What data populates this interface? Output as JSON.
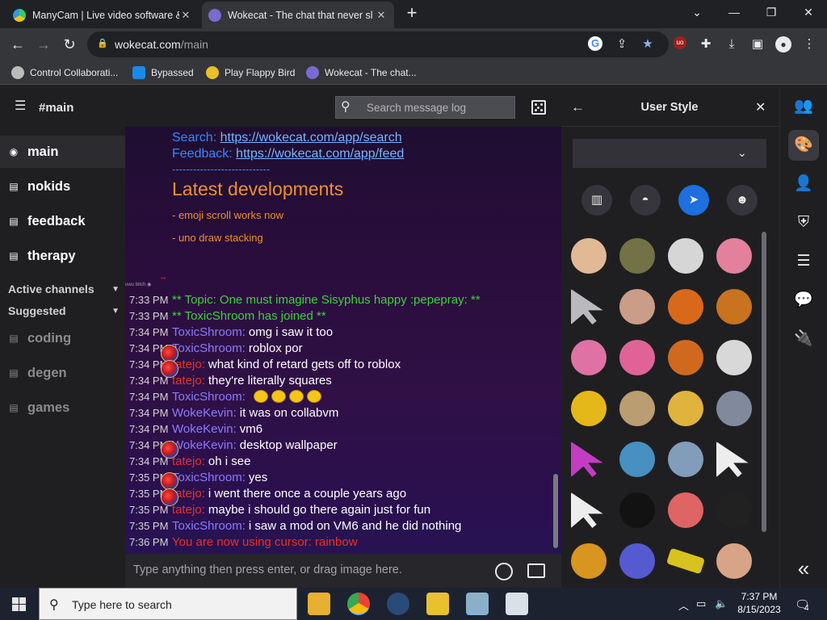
{
  "browser": {
    "tabs": [
      {
        "title": "ManyCam | Live video software &",
        "active": false
      },
      {
        "title": "Wokecat - The chat that never sl",
        "active": true
      }
    ],
    "url_host": "wokecat.com",
    "url_path": "/main",
    "bookmarks": [
      {
        "label": "Control Collaborati..."
      },
      {
        "label": "Bypassed"
      },
      {
        "label": "Play Flappy Bird"
      },
      {
        "label": "Wokecat - The chat..."
      }
    ]
  },
  "sidebar": {
    "channel_title": "#main",
    "channels": [
      {
        "label": "main",
        "icon": "eye-icon"
      },
      {
        "label": "nokids",
        "icon": "comment-icon"
      },
      {
        "label": "feedback",
        "icon": "comment-icon"
      },
      {
        "label": "therapy",
        "icon": "comment-icon"
      }
    ],
    "sections": [
      {
        "label": "Active channels"
      },
      {
        "label": "Suggested"
      }
    ],
    "suggested": [
      {
        "label": "coding"
      },
      {
        "label": "degen"
      },
      {
        "label": "games"
      }
    ]
  },
  "chat": {
    "search_placeholder": "Search message log",
    "motd": {
      "search_label": "Search:",
      "search_link": "https://wokecat.com/app/search",
      "feedback_label": "Feedback:",
      "feedback_link": "https://wokecat.com/app/feed",
      "divider": "----------------------------"
    },
    "dev_title": "Latest developments",
    "dev_items": [
      "- emoji scroll works now",
      "- uno draw stacking"
    ],
    "tiny_text": "uwu bitch ◉",
    "tiny_red": "**",
    "messages": [
      {
        "time": "7:33 PM",
        "nick": "",
        "text": "** Topic: One must imagine Sisyphus happy :pepepray: **",
        "color": "#3cd23c"
      },
      {
        "time": "7:33 PM",
        "nick": "",
        "text": "** ToxicShroom has joined **",
        "color": "#3cd23c"
      },
      {
        "time": "7:34 PM",
        "nick": "ToxicShroom:",
        "text": "omg i saw it too",
        "color": "#8a7cff"
      },
      {
        "time": "7:34 PM",
        "nick": "ToxicShroom:",
        "text": "roblox por",
        "color": "#8a7cff"
      },
      {
        "time": "7:34 PM",
        "nick": "tatejo:",
        "text": "what kind of retard gets off to roblox",
        "color": "#e8322a"
      },
      {
        "time": "7:34 PM",
        "nick": "tatejo:",
        "text": "they're literally squares",
        "color": "#e8322a"
      },
      {
        "time": "7:34 PM",
        "nick": "ToxicShroom:",
        "text": "",
        "color": "#8a7cff"
      },
      {
        "time": "7:34 PM",
        "nick": "WokeKevin:",
        "text": "it was on collabvm",
        "color": "#8a7cff"
      },
      {
        "time": "7:34 PM",
        "nick": "WokeKevin:",
        "text": "vm6",
        "color": "#8a7cff"
      },
      {
        "time": "7:34 PM",
        "nick": "WokeKevin:",
        "text": "desktop wallpaper",
        "color": "#8a7cff"
      },
      {
        "time": "7:34 PM",
        "nick": "tatejo:",
        "text": "oh i see",
        "color": "#e8322a"
      },
      {
        "time": "7:35 PM",
        "nick": "ToxicShroom:",
        "text": "yes",
        "color": "#8a7cff"
      },
      {
        "time": "7:35 PM",
        "nick": "tatejo:",
        "text": "i went there once a couple years ago",
        "color": "#e8322a"
      },
      {
        "time": "7:35 PM",
        "nick": "tatejo:",
        "text": "maybe i should go there again just for fun",
        "color": "#e8322a"
      },
      {
        "time": "7:35 PM",
        "nick": "ToxicShroom:",
        "text": "i saw a mod on VM6 and he did nothing",
        "color": "#8a7cff"
      },
      {
        "time": "7:36 PM",
        "nick": "",
        "text": "You are now using cursor: rainbow",
        "color": "#e8322a"
      }
    ],
    "input_placeholder": "Type anything then press enter, or drag image here."
  },
  "user_style": {
    "title": "User Style",
    "select_value": "",
    "categories": [
      {
        "icon": "vest-icon",
        "selected": false
      },
      {
        "icon": "hat-icon",
        "selected": false
      },
      {
        "icon": "cursor-icon",
        "selected": true
      },
      {
        "icon": "face-icon",
        "selected": false
      }
    ],
    "cursors": [
      {
        "name": "toast-cat",
        "color": "#f2c8a0"
      },
      {
        "name": "doge",
        "color": "#7a7a4a"
      },
      {
        "name": "sphere",
        "color": "#e6e6e6"
      },
      {
        "name": "pink-bow",
        "color": "#f48aa8"
      },
      {
        "name": "white-arrow",
        "color": "#c8c8cc"
      },
      {
        "name": "flesh",
        "color": "#d8a890"
      },
      {
        "name": "dorito",
        "color": "#e8701a"
      },
      {
        "name": "needle",
        "color": "#d87a20"
      },
      {
        "name": "pink-fish",
        "color": "#f07ab0"
      },
      {
        "name": "pink-flower",
        "color": "#f06aa0"
      },
      {
        "name": "fox",
        "color": "#e0701e"
      },
      {
        "name": "hamster",
        "color": "#e8e8e8"
      },
      {
        "name": "laughing-emoji",
        "color": "#f5c518"
      },
      {
        "name": "cat-figure",
        "color": "#c8a878"
      },
      {
        "name": "pencil",
        "color": "#f0c040"
      },
      {
        "name": "pigeon",
        "color": "#8a92a8"
      },
      {
        "name": "rainbow-arrow",
        "color": "#d040d0"
      },
      {
        "name": "sad-face",
        "color": "#4a9ad0"
      },
      {
        "name": "shark",
        "color": "#8aa8c8"
      },
      {
        "name": "black-arrow",
        "color": "#ffffff"
      },
      {
        "name": "white-arrow-2",
        "color": "#ffffff"
      },
      {
        "name": "yin-yang",
        "color": "#111111"
      },
      {
        "name": "small-figure",
        "color": "#f06a6a"
      },
      {
        "name": "swirl",
        "color": "#222222"
      },
      {
        "name": "taco",
        "color": "#e8a020"
      },
      {
        "name": "rainbow-trail",
        "color": "#5a60e0"
      },
      {
        "name": "true-text",
        "color": "#e8d020"
      },
      {
        "name": "face-photo",
        "color": "#e8b090"
      }
    ]
  },
  "rail": {
    "icons": [
      "users-icon",
      "palette-icon",
      "user-icon",
      "shield-icon",
      "sliders-icon",
      "chat-icon",
      "plug-icon",
      "double-chevron-left-icon"
    ]
  },
  "taskbar": {
    "search_placeholder": "Type here to search",
    "time": "7:37 PM",
    "date": "8/15/2023",
    "notif_count": "4"
  }
}
